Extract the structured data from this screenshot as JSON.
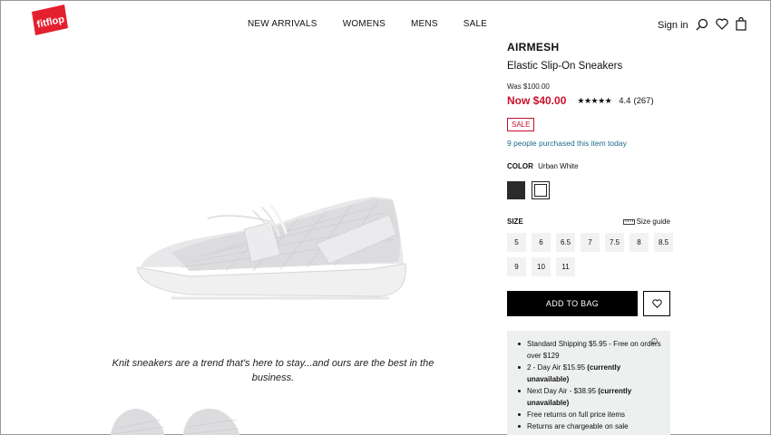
{
  "logo": {
    "text": "fitflop",
    "color": "#e5202e"
  },
  "nav": {
    "items": [
      "NEW ARRIVALS",
      "WOMENS",
      "MENS",
      "SALE"
    ]
  },
  "header": {
    "sign_in": "Sign in",
    "icons": [
      "search-icon",
      "heart-icon",
      "bag-icon"
    ]
  },
  "product": {
    "brand": "AIRMESH",
    "name": "Elastic Slip-On Sneakers",
    "was_price": "Was $100.00",
    "now_price": "Now $40.00",
    "stars": "★★★★★",
    "rating_value": 4.4,
    "rating": "4.4",
    "review_count": "(267)",
    "sale_badge": "SALE",
    "purchased_note": "9 people purchased this item today",
    "color_label": "COLOR",
    "color_value": "Urban White",
    "swatch_colors": [
      "#2b2b2b",
      "#ffffff"
    ],
    "size_label": "SIZE",
    "size_guide": "Size guide",
    "sizes": [
      "5",
      "6",
      "6.5",
      "7",
      "7.5",
      "8",
      "8.5",
      "9",
      "10",
      "11"
    ],
    "add_to_bag": "ADD TO BAG",
    "shipping": {
      "line1_a": "Standard Shipping $5.95 - Free on orders over $129",
      "line2_a": "2 - Day Air $15.95 ",
      "line2_b": "(currently unavailable)",
      "line3_a": "Next Day Air -  $38.95 ",
      "line3_b": "(currently unavailable)",
      "line4": "Free returns on full price items",
      "line5": "Returns are chargeable on sale"
    }
  },
  "content": {
    "quote": "Knit sneakers are a trend that's here to stay...and ours are the best in the business."
  },
  "colors": {
    "sale_red": "#c8102e",
    "link_blue": "#1b6a8d",
    "shipping_bg": "#eef0f0"
  }
}
